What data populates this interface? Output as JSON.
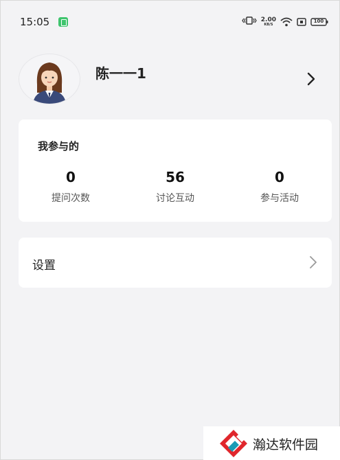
{
  "status_bar": {
    "time": "15:05",
    "net_speed_value": "2.00",
    "net_speed_unit": "KB/S",
    "battery_level": "100",
    "icons": [
      "app-notification-icon",
      "vibrate-icon",
      "wifi-icon",
      "sim-icon",
      "battery-icon"
    ]
  },
  "profile": {
    "name": "陈一一1",
    "avatar_icon": "female-avatar-icon",
    "arrow_icon": "chevron-right-icon"
  },
  "participation": {
    "title": "我参与的",
    "stats": [
      {
        "value": "0",
        "label": "提问次数"
      },
      {
        "value": "56",
        "label": "讨论互动"
      },
      {
        "value": "0",
        "label": "参与活动"
      }
    ]
  },
  "settings": {
    "label": "设置",
    "arrow_icon": "chevron-right-icon"
  },
  "watermark": {
    "text": "瀚达软件园"
  },
  "colors": {
    "background": "#f3f3f5",
    "card": "#ffffff",
    "status_green": "#3ec46d",
    "logo_red": "#e0262c",
    "logo_teal": "#1a9bb5"
  }
}
